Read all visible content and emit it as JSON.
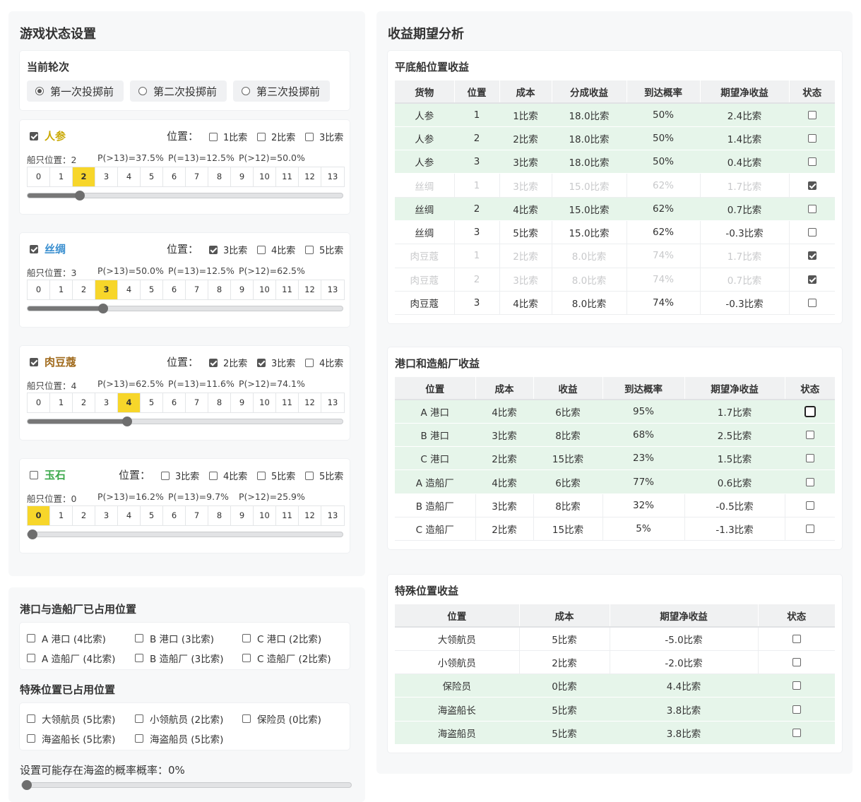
{
  "left": {
    "title": "游戏状态设置",
    "round": {
      "label": "当前轮次",
      "options": [
        "第一次投掷前",
        "第二次投掷前",
        "第三次投掷前"
      ]
    },
    "goods": [
      {
        "name": "人参",
        "color": "#c9a800",
        "checked": true,
        "pos_label": "位置：",
        "options": [
          {
            "label": "1比索",
            "checked": false
          },
          {
            "label": "2比索",
            "checked": false
          },
          {
            "label": "3比索",
            "checked": false
          }
        ],
        "ship": "船只位置：2",
        "p1": "P(>13)=37.5%",
        "p2": "P(=13)=12.5%",
        "p3": "P(>12)=50.0%",
        "value": 2
      },
      {
        "name": "丝绸",
        "color": "#3a8fd0",
        "checked": true,
        "pos_label": "位置：",
        "options": [
          {
            "label": "3比索",
            "checked": true
          },
          {
            "label": "4比索",
            "checked": false
          },
          {
            "label": "5比索",
            "checked": false
          }
        ],
        "ship": "船只位置：3",
        "p1": "P(>13)=50.0%",
        "p2": "P(=13)=12.5%",
        "p3": "P(>12)=62.5%",
        "value": 3
      },
      {
        "name": "肉豆蔻",
        "color": "#a06a1c",
        "checked": true,
        "pos_label": "位置：",
        "options": [
          {
            "label": "2比索",
            "checked": true
          },
          {
            "label": "3比索",
            "checked": true
          },
          {
            "label": "4比索",
            "checked": false
          }
        ],
        "ship": "船只位置：4",
        "p1": "P(>13)=62.5%",
        "p2": "P(=13)=11.6%",
        "p3": "P(>12)=74.1%",
        "value": 4
      },
      {
        "name": "玉石",
        "color": "#3aa84a",
        "checked": false,
        "pos_label": "位置：",
        "options": [
          {
            "label": "3比索",
            "checked": false
          },
          {
            "label": "4比索",
            "checked": false
          },
          {
            "label": "5比索",
            "checked": false
          },
          {
            "label": "5比索",
            "checked": false
          }
        ],
        "ship": "船只位置：0",
        "p1": "P(>13)=16.2%",
        "p2": "P(=13)=9.7%",
        "p3": "P(>12)=25.9%",
        "value": 0
      }
    ],
    "cells": [
      "0",
      "1",
      "2",
      "3",
      "4",
      "5",
      "6",
      "7",
      "8",
      "9",
      "10",
      "11",
      "12",
      "13"
    ]
  },
  "occupied": {
    "port_title": "港口与造船厂已占用位置",
    "port_options": [
      "A 港口 (4比索)",
      "B 港口 (3比索)",
      "C 港口 (2比索)",
      "A 造船厂 (4比索)",
      "B 造船厂 (3比索)",
      "C 造船厂 (2比索)"
    ],
    "special_title": "特殊位置已占用位置",
    "special_options": [
      "大领航员 (5比索)",
      "小领航员 (2比索)",
      "保险员 (0比索)",
      "海盗船长 (5比索)",
      "海盗船员 (5比索)"
    ],
    "pirate_label": "设置可能存在海盗的概率概率：0%",
    "pirate_value": 0
  },
  "right": {
    "title": "收益期望分析",
    "boat": {
      "title": "平底船位置收益",
      "headers": [
        "货物",
        "位置",
        "成本",
        "分成收益",
        "到达概率",
        "期望净收益",
        "状态"
      ],
      "rows": [
        {
          "cells": [
            "人参",
            "1",
            "1比索",
            "18.0比索",
            "50%",
            "2.4比索"
          ],
          "checked": false,
          "style": "g"
        },
        {
          "cells": [
            "人参",
            "2",
            "2比索",
            "18.0比索",
            "50%",
            "1.4比索"
          ],
          "checked": false,
          "style": "g"
        },
        {
          "cells": [
            "人参",
            "3",
            "3比索",
            "18.0比索",
            "50%",
            "0.4比索"
          ],
          "checked": false,
          "style": "g"
        },
        {
          "cells": [
            "丝绸",
            "1",
            "3比索",
            "15.0比索",
            "62%",
            "1.7比索"
          ],
          "checked": true,
          "style": "dim"
        },
        {
          "cells": [
            "丝绸",
            "2",
            "4比索",
            "15.0比索",
            "62%",
            "0.7比索"
          ],
          "checked": false,
          "style": "g"
        },
        {
          "cells": [
            "丝绸",
            "3",
            "5比索",
            "15.0比索",
            "62%",
            "-0.3比索"
          ],
          "checked": false,
          "style": ""
        },
        {
          "cells": [
            "肉豆蔻",
            "1",
            "2比索",
            "8.0比索",
            "74%",
            "1.7比索"
          ],
          "checked": true,
          "style": "dim"
        },
        {
          "cells": [
            "肉豆蔻",
            "2",
            "3比索",
            "8.0比索",
            "74%",
            "0.7比索"
          ],
          "checked": true,
          "style": "dim"
        },
        {
          "cells": [
            "肉豆蔻",
            "3",
            "4比索",
            "8.0比索",
            "74%",
            "-0.3比索"
          ],
          "checked": false,
          "style": ""
        }
      ]
    },
    "port": {
      "title": "港口和造船厂收益",
      "headers": [
        "位置",
        "成本",
        "收益",
        "到达概率",
        "期望净收益",
        "状态"
      ],
      "rows": [
        {
          "cells": [
            "A 港口",
            "4比索",
            "6比索",
            "95%",
            "1.7比索"
          ],
          "checked": false,
          "style": "g",
          "focus": true
        },
        {
          "cells": [
            "B 港口",
            "3比索",
            "8比索",
            "68%",
            "2.5比索"
          ],
          "checked": false,
          "style": "g"
        },
        {
          "cells": [
            "C 港口",
            "2比索",
            "15比索",
            "23%",
            "1.5比索"
          ],
          "checked": false,
          "style": "g"
        },
        {
          "cells": [
            "A 造船厂",
            "4比索",
            "6比索",
            "77%",
            "0.6比索"
          ],
          "checked": false,
          "style": "g"
        },
        {
          "cells": [
            "B 造船厂",
            "3比索",
            "8比索",
            "32%",
            "-0.5比索"
          ],
          "checked": false,
          "style": ""
        },
        {
          "cells": [
            "C 造船厂",
            "2比索",
            "15比索",
            "5%",
            "-1.3比索"
          ],
          "checked": false,
          "style": ""
        }
      ]
    },
    "special": {
      "title": "特殊位置收益",
      "headers": [
        "位置",
        "成本",
        "期望净收益",
        "状态"
      ],
      "rows": [
        {
          "cells": [
            "大领航员",
            "5比索",
            "-5.0比索"
          ],
          "checked": false,
          "style": ""
        },
        {
          "cells": [
            "小领航员",
            "2比索",
            "-2.0比索"
          ],
          "checked": false,
          "style": ""
        },
        {
          "cells": [
            "保险员",
            "0比索",
            "4.4比索"
          ],
          "checked": false,
          "style": "g"
        },
        {
          "cells": [
            "海盗船长",
            "5比索",
            "3.8比索"
          ],
          "checked": false,
          "style": "g"
        },
        {
          "cells": [
            "海盗船员",
            "5比索",
            "3.8比索"
          ],
          "checked": false,
          "style": "g"
        }
      ]
    }
  }
}
